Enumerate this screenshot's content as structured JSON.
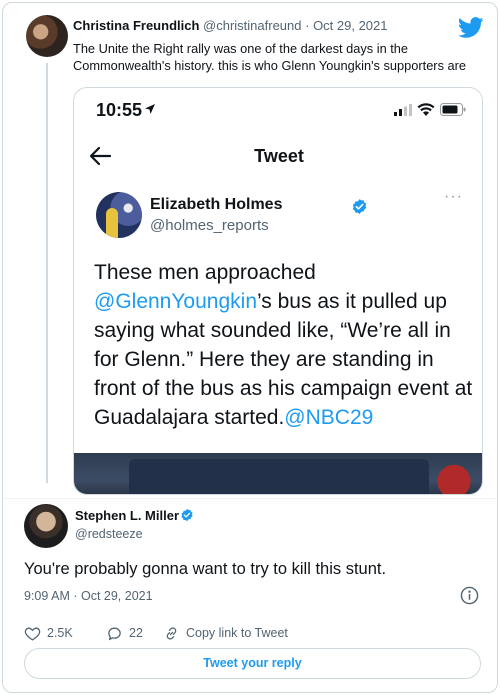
{
  "quoted_tweet": {
    "author_name": "Christina Freundlich",
    "author_handle": "@christinafreund",
    "separator": " · ",
    "date": "Oct 29, 2021",
    "text": "The Unite the Right rally was one of the darkest days in the Commonwealth's history. this is who Glenn Youngkin's supporters are"
  },
  "screenshot": {
    "status_time": "10:55",
    "nav_title": "Tweet",
    "author_name": "Elizabeth Holmes",
    "author_handle": "@holmes_reports",
    "more": "···",
    "text_parts": {
      "mention1": "@GlennYoungkin",
      "body": "’s bus as it pulled up saying what sounded like, “We’re all in for Glenn.” Here they are standing in front of the bus as his campaign event at Guadalajara started.",
      "lead": "These men approached ",
      "mention2": "@NBC29"
    }
  },
  "main_tweet": {
    "author_name": "Stephen L. Miller",
    "author_handle": "@redsteeze",
    "text": "You're probably gonna want to try to kill this stunt.",
    "timestamp": "9:09 AM · Oct 29, 2021",
    "likes": "2.5K",
    "replies": "22",
    "copy_link": "Copy link to Tweet",
    "reply_button": "Tweet your reply"
  },
  "colors": {
    "accent": "#1d9bf0",
    "text": "#0f1419",
    "muted": "#536471",
    "border": "#cfd9de"
  },
  "icons": [
    "twitter-bird-icon",
    "location-arrow-icon",
    "signal-icon",
    "wifi-icon",
    "battery-icon",
    "back-arrow-icon",
    "verified-badge-icon",
    "info-icon",
    "heart-icon",
    "reply-icon",
    "link-icon"
  ]
}
